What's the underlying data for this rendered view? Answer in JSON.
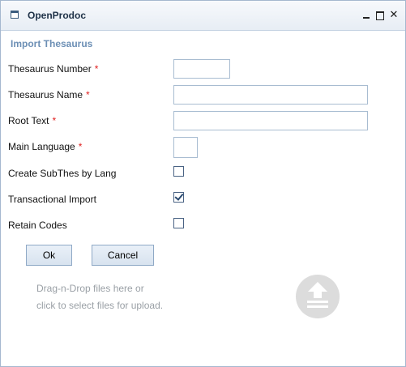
{
  "window": {
    "title": "OpenProdoc",
    "icon": "window-icon"
  },
  "form": {
    "title": "Import Thesaurus",
    "fields": [
      {
        "label": "Thesaurus Number",
        "required": "*",
        "value": ""
      },
      {
        "label": "Thesaurus Name",
        "required": "*",
        "value": ""
      },
      {
        "label": "Root Text",
        "required": "*",
        "value": ""
      },
      {
        "label": "Main Language",
        "required": "*",
        "value": ""
      }
    ],
    "checkboxes": [
      {
        "label": "Create SubThes by Lang",
        "checked": false
      },
      {
        "label": "Transactional Import",
        "checked": true
      },
      {
        "label": "Retain Codes",
        "checked": false
      }
    ]
  },
  "buttons": {
    "ok": "Ok",
    "cancel": "Cancel"
  },
  "dropzone": {
    "line1": "Drag-n-Drop files here or",
    "line2": "click to select files for upload.",
    "icon": "upload-icon"
  }
}
